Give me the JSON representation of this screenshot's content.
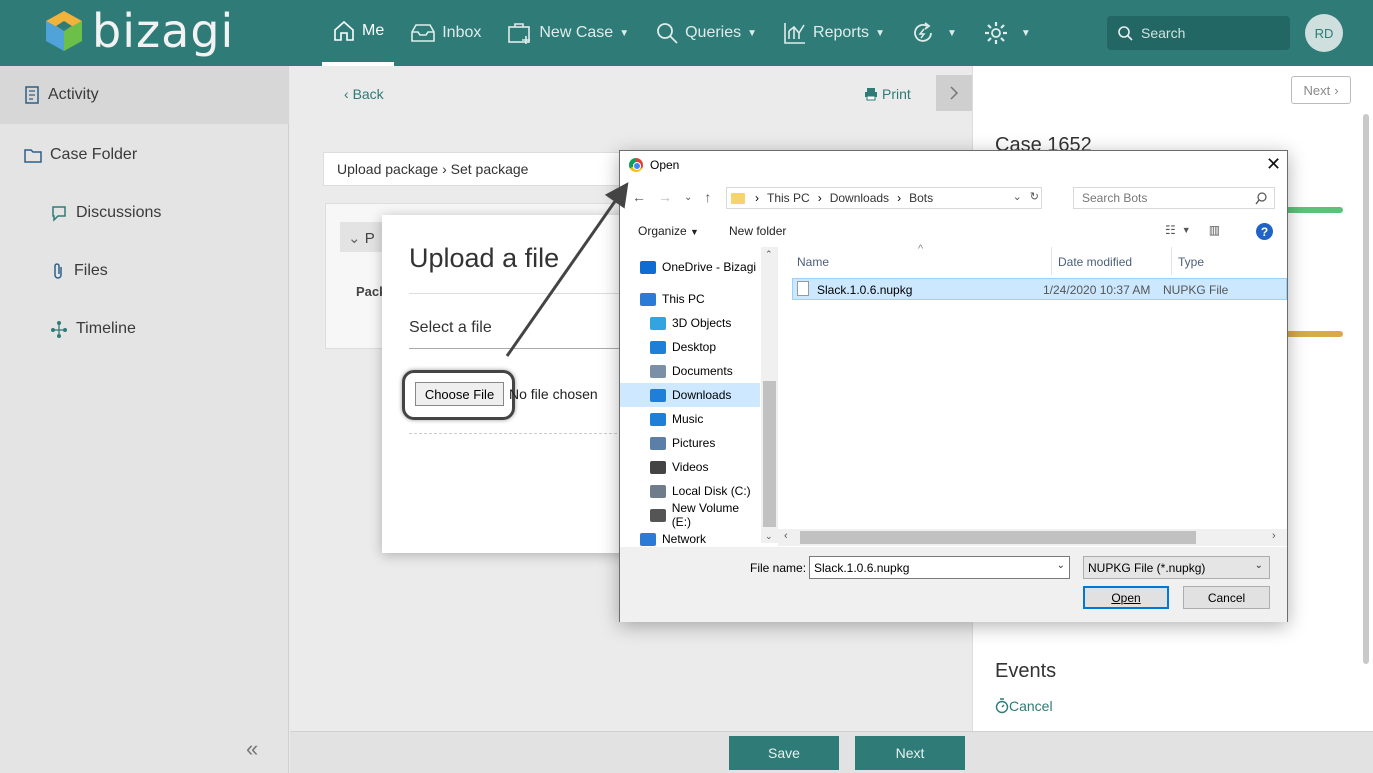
{
  "app": {
    "logo_text": "bizagi",
    "avatar_initials": "RD"
  },
  "nav": {
    "items": [
      {
        "label": "Me",
        "active": true
      },
      {
        "label": "Inbox"
      },
      {
        "label": "New Case",
        "dropdown": true
      },
      {
        "label": "Queries",
        "dropdown": true
      },
      {
        "label": "Reports",
        "dropdown": true
      }
    ],
    "search_placeholder": "Search"
  },
  "sidebar": {
    "items": [
      {
        "label": "Activity",
        "icon": "activity-icon"
      },
      {
        "label": "Case Folder",
        "icon": "folder-icon"
      },
      {
        "label": "Discussions",
        "icon": "chat-icon"
      },
      {
        "label": "Files",
        "icon": "paperclip-icon"
      },
      {
        "label": "Timeline",
        "icon": "timeline-icon"
      }
    ],
    "collapse_glyph": "«"
  },
  "main": {
    "back_label": "Back",
    "print_label": "Print",
    "breadcrumb": "Upload package › Set package",
    "panel_head": "P",
    "panel_field": "Pack"
  },
  "upload": {
    "title": "Upload a file",
    "select_label": "Select a file",
    "choose_label": "Choose File",
    "no_file": "No file chosen"
  },
  "right": {
    "next_label": "Next",
    "case_title": "Case 1652",
    "events_title": "Events",
    "cancel_label": "Cancel"
  },
  "footer": {
    "save_label": "Save",
    "next_label": "Next"
  },
  "dialog": {
    "title": "Open",
    "path": [
      "This PC",
      "Downloads",
      "Bots"
    ],
    "search_placeholder": "Search Bots",
    "organize_label": "Organize",
    "new_folder_label": "New folder",
    "help_glyph": "?",
    "nav_items": [
      {
        "label": "OneDrive - Bizagi",
        "icon": "onedrive-icon",
        "color": "#0f6cd1"
      },
      {
        "label": "This PC",
        "icon": "computer-icon",
        "color": "#2b7bd6"
      },
      {
        "label": "3D Objects",
        "icon": "cube-icon",
        "color": "#33a4e0"
      },
      {
        "label": "Desktop",
        "icon": "desktop-icon",
        "color": "#1f7fd6"
      },
      {
        "label": "Documents",
        "icon": "document-icon",
        "color": "#7b8fa8"
      },
      {
        "label": "Downloads",
        "icon": "download-icon",
        "color": "#1f7fd6",
        "selected": true
      },
      {
        "label": "Music",
        "icon": "music-icon",
        "color": "#1f7fd6"
      },
      {
        "label": "Pictures",
        "icon": "pictures-icon",
        "color": "#5b7fa6"
      },
      {
        "label": "Videos",
        "icon": "video-icon",
        "color": "#444444"
      },
      {
        "label": "Local Disk (C:)",
        "icon": "disk-icon",
        "color": "#6f7c8a"
      },
      {
        "label": "New Volume (E:)",
        "icon": "drive-icon",
        "color": "#555555"
      },
      {
        "label": "Network",
        "icon": "network-icon",
        "color": "#2b7bd6"
      }
    ],
    "columns": [
      "Name",
      "Date modified",
      "Type"
    ],
    "files": [
      {
        "name": "Slack.1.0.6.nupkg",
        "date": "1/24/2020 10:37 AM",
        "type": "NUPKG File"
      }
    ],
    "file_name_label": "File name:",
    "file_name_value": "Slack.1.0.6.nupkg",
    "file_type_value": "NUPKG File (*.nupkg)",
    "open_label": "Open",
    "cancel_label": "Cancel"
  }
}
